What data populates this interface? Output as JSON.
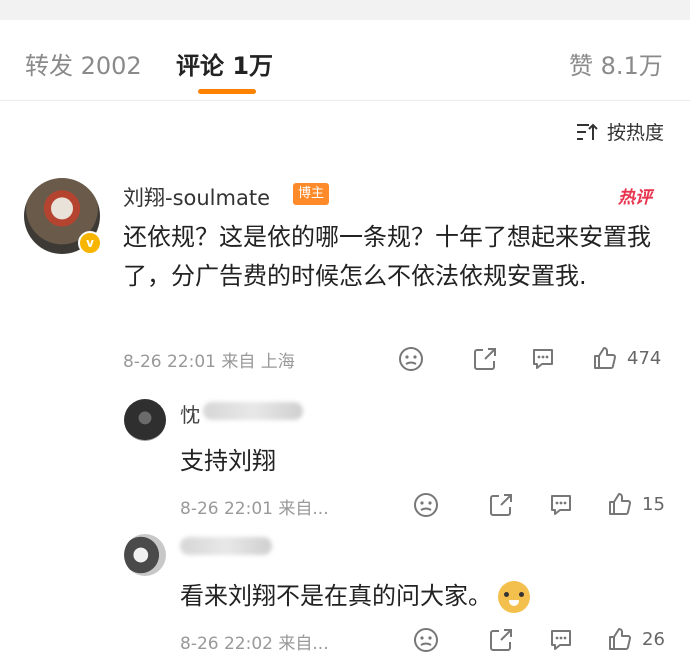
{
  "tabs": {
    "repost": "转发 2002",
    "comment": "评论 1万",
    "like": "赞 8.1万"
  },
  "sort": {
    "label": "按热度",
    "icon": "sort-icon"
  },
  "comment": {
    "username": "刘翔-soulmate",
    "tag": "博主",
    "hot_label": "热评",
    "text": "还依规？这是依的哪一条规？十年了想起来安置我了，分广告费的时候怎么不依法依规安置我.",
    "meta": "8-26 22:01 来自 上海",
    "likes": "474"
  },
  "replies": [
    {
      "name": "忱",
      "text": "支持刘翔",
      "meta": "8-26 22:01 来自...",
      "likes": "15"
    },
    {
      "name": "",
      "text": "看来刘翔不是在真的问大家。",
      "meta": "8-26 22:02 来自...",
      "likes": "26"
    }
  ],
  "colors": {
    "accent": "#ff8200",
    "hot": "#e8344e",
    "verified": "#f7b500"
  }
}
